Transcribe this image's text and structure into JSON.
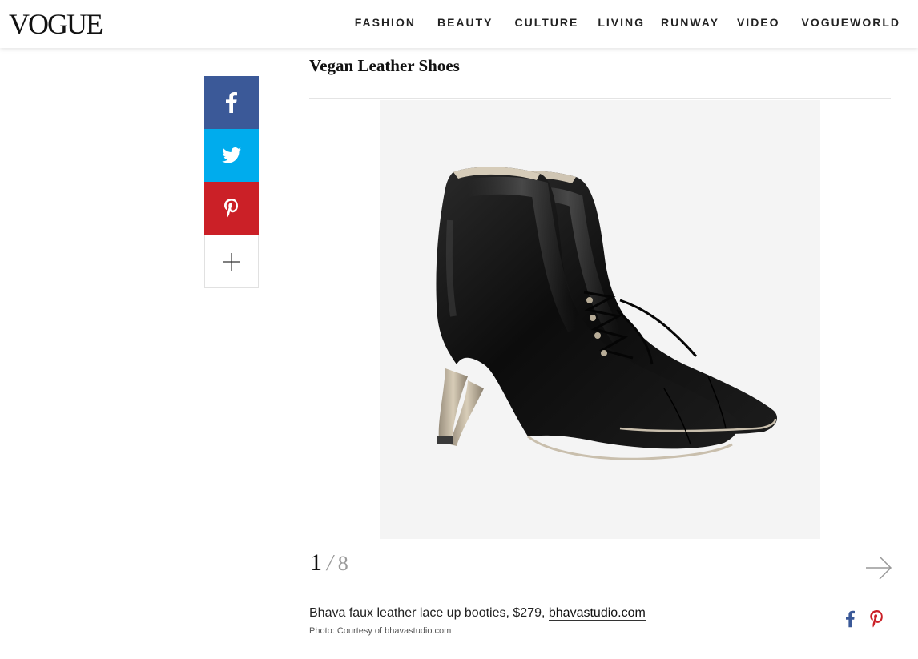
{
  "header": {
    "logo": "VOGUE",
    "nav": [
      "FASHION",
      "BEAUTY",
      "CULTURE",
      "LIVING",
      "RUNWAY",
      "VIDEO",
      "VOGUEWORLD"
    ]
  },
  "share": {
    "facebook_color": "#3b5998",
    "twitter_color": "#00aced",
    "pinterest_color": "#cb2027"
  },
  "slide": {
    "title": "Vegan Leather Shoes",
    "current": "1",
    "separator": "/",
    "total": "8",
    "caption_text": "Bhava faux leather lace up booties, $279, ",
    "caption_link": "bhavastudio.com",
    "credit": "Photo: Courtesy of bhavastudio.com"
  }
}
